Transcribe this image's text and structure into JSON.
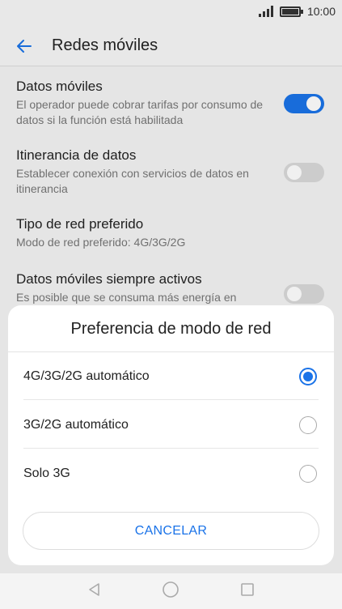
{
  "status_bar": {
    "time": "10:00",
    "signal_icon": "signal-bars-icon",
    "battery_icon": "battery-icon"
  },
  "app_bar": {
    "title": "Redes móviles",
    "back_icon": "arrow-left-icon"
  },
  "settings": [
    {
      "title": "Datos móviles",
      "subtitle": "El operador puede cobrar tarifas por consumo de datos si la función está habilitada",
      "toggle": "on"
    },
    {
      "title": "Itinerancia de datos",
      "subtitle": "Establecer conexión con servicios de datos en itinerancia",
      "toggle": "off"
    },
    {
      "title": "Tipo de red preferido",
      "subtitle": "Modo de red preferido: 4G/3G/2G"
    },
    {
      "title": "Datos móviles siempre activos",
      "subtitle": "Es posible que se consuma más energía en",
      "toggle": "off"
    }
  ],
  "dialog": {
    "title": "Preferencia de modo de red",
    "options": [
      {
        "label": "4G/3G/2G automático",
        "selected": true
      },
      {
        "label": "3G/2G automático",
        "selected": false
      },
      {
        "label": "Solo 3G",
        "selected": false
      }
    ],
    "cancel_label": "CANCELAR"
  },
  "nav_bar": {
    "back": "triangle-back-icon",
    "home": "circle-home-icon",
    "recents": "square-recents-icon"
  },
  "colors": {
    "accent": "#1a73e8",
    "toggle_off": "#d9d9d9",
    "background": "#f4f4f4"
  }
}
